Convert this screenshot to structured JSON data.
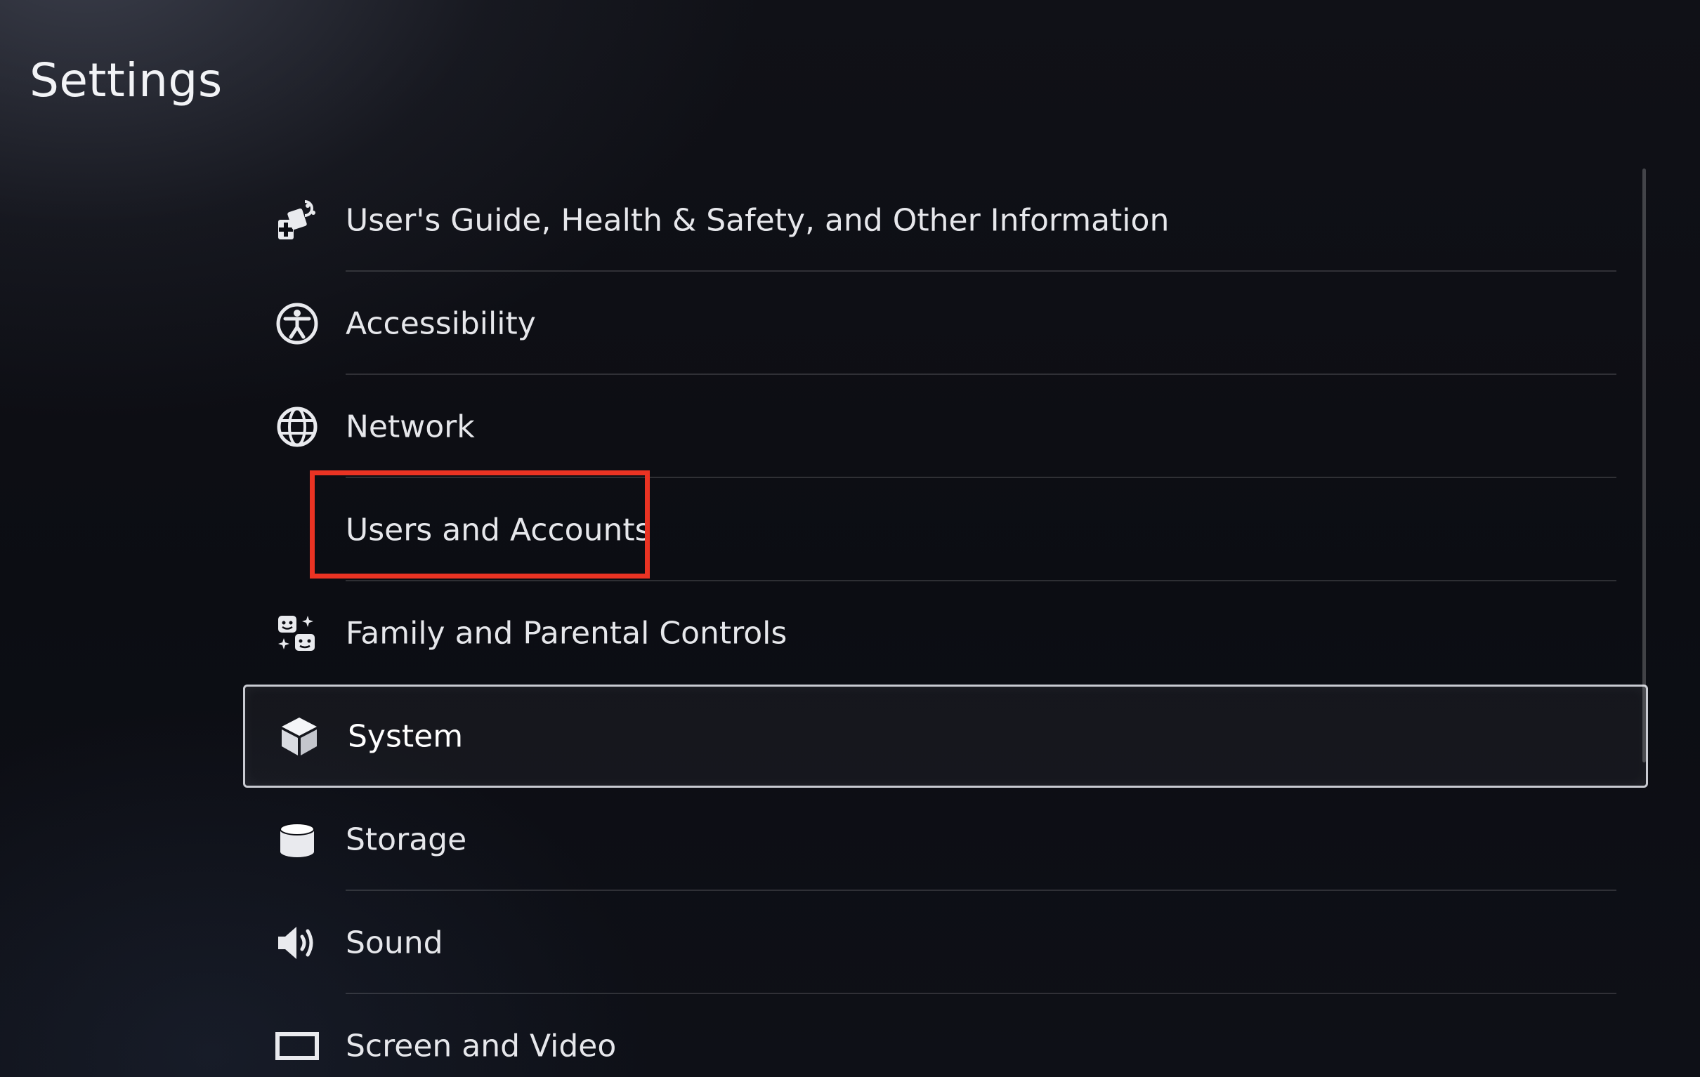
{
  "page": {
    "title": "Settings"
  },
  "menu": {
    "items": [
      {
        "label": "User's Guide, Health & Safety, and Other Information",
        "icon": "guide-info-icon",
        "selected": false
      },
      {
        "label": "Accessibility",
        "icon": "accessibility-icon",
        "selected": false
      },
      {
        "label": "Network",
        "icon": "globe-icon",
        "selected": false
      },
      {
        "label": "Users and Accounts",
        "icon": "users-accounts-icon",
        "selected": false
      },
      {
        "label": "Family and Parental Controls",
        "icon": "family-controls-icon",
        "selected": false
      },
      {
        "label": "System",
        "icon": "cube-icon",
        "selected": true
      },
      {
        "label": "Storage",
        "icon": "storage-cylinder-icon",
        "selected": false
      },
      {
        "label": "Sound",
        "icon": "speaker-icon",
        "selected": false
      },
      {
        "label": "Screen and Video",
        "icon": "screen-icon",
        "selected": false
      }
    ]
  },
  "annotation": {
    "highlight_color": "#ea3323",
    "highlighted_item": "Users and Accounts"
  },
  "colors": {
    "background": "#0c0d13",
    "text": "#e6e7eb",
    "selection_border": "#c9cbd2"
  }
}
